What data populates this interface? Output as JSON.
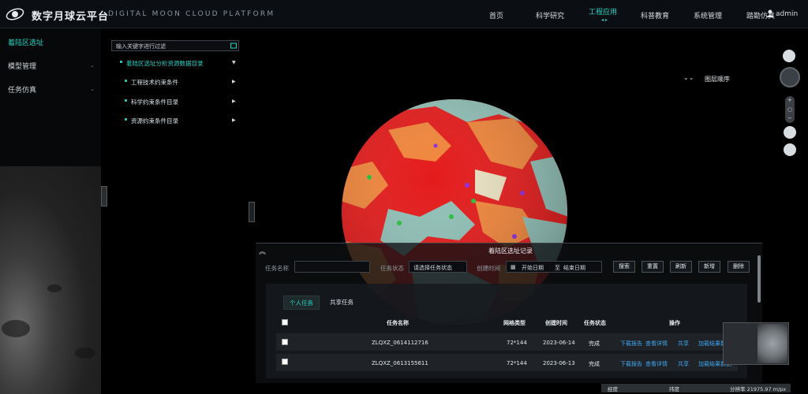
{
  "header": {
    "title": "数字月球云平台",
    "subtitle": "DIGITAL MOON CLOUD PLATFORM",
    "nav": [
      "首页",
      "科学研究",
      "工程应用",
      "科普教育",
      "系统管理",
      "踏勘仿真"
    ],
    "active_nav": "工程应用",
    "user": "admin"
  },
  "sidebar": {
    "items": [
      {
        "label": "着陆区选址",
        "active": true
      },
      {
        "label": "模型管理",
        "active": false
      },
      {
        "label": "任务仿真",
        "active": false
      }
    ]
  },
  "tree": {
    "search_placeholder": "输入关键字进行过滤",
    "root": "着陆区选址分析资源数据目录",
    "children": [
      "工程技术约束条件",
      "科学约束条件目录",
      "资源约束条件目录"
    ]
  },
  "map_tools": {
    "layer_order_label": "图层顺序"
  },
  "records": {
    "title": "着陆区选址记录",
    "filters": {
      "task_name_label": "任务名称",
      "task_status_label": "任务状态",
      "task_status_placeholder": "请选择任务状态",
      "created_time_label": "创建时间",
      "start_date_placeholder": "开始日期",
      "to_label": "至",
      "end_date_placeholder": "结束日期"
    },
    "buttons": [
      "搜索",
      "重置",
      "刷新",
      "新增",
      "删除"
    ],
    "tabs": [
      "个人任务",
      "共享任务"
    ],
    "columns": [
      "任务名称",
      "网格类型",
      "创建时间",
      "任务状态",
      "操作"
    ],
    "rows": [
      {
        "name": "ZLQXZ_0614112716",
        "grid": "72*144",
        "date": "2023-06-14",
        "status": "完成",
        "actions": [
          "下载报告",
          "查看详情",
          "共享",
          "加载结果数据"
        ]
      },
      {
        "name": "ZLQXZ_0613155611",
        "grid": "72*144",
        "date": "2023-06-13",
        "status": "完成",
        "actions": [
          "下载报告",
          "查看详情",
          "共享",
          "加载结果数据"
        ]
      }
    ]
  },
  "statusbar": {
    "lon_label": "经度",
    "lat_label": "纬度",
    "resolution": "分辨率 21975.97 m/px"
  },
  "colors": {
    "accent": "#27d3c5",
    "link": "#3ea6f0",
    "globe_red": "#e41a1a",
    "globe_orange": "#f0853a",
    "globe_teal": "#8fbfb5"
  }
}
